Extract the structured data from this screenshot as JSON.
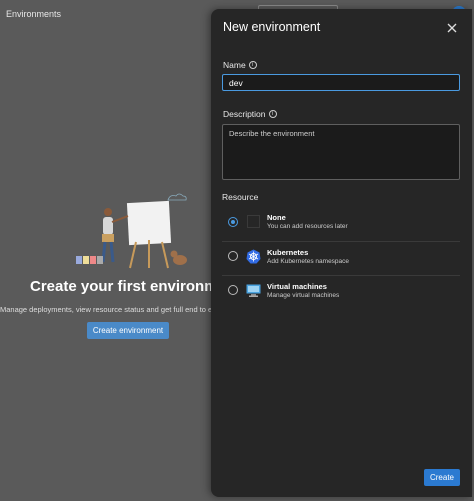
{
  "background": {
    "header_title": "Environments",
    "empty_title": "Create your first environment",
    "empty_description": "Manage deployments, view resource status and get full end to end",
    "create_button": "Create environment"
  },
  "panel": {
    "title": "New environment",
    "name_label": "Name",
    "name_value": "dev",
    "description_label": "Description",
    "description_placeholder": "Describe the environment",
    "resource_label": "Resource",
    "resources": [
      {
        "title": "None",
        "subtitle": "You can add resources later",
        "icon": "empty-box-icon",
        "selected": true
      },
      {
        "title": "Kubernetes",
        "subtitle": "Add Kubernetes namespace",
        "icon": "kubernetes-icon",
        "selected": false
      },
      {
        "title": "Virtual machines",
        "subtitle": "Manage virtual machines",
        "icon": "virtual-machine-icon",
        "selected": false
      }
    ],
    "create_label": "Create"
  },
  "colors": {
    "accent": "#2b7ad1",
    "panel_bg": "#262626",
    "overlay_bg": "#5a5a5a"
  }
}
